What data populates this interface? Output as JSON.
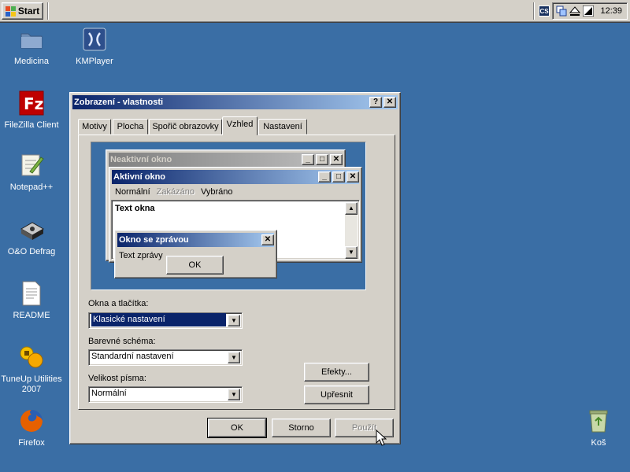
{
  "taskbar": {
    "start_label": "Start",
    "clock": "12:39",
    "tray_icons": [
      "cs-icon",
      "network-icon",
      "eject-icon",
      "volume-icon"
    ],
    "cs_label": "CS"
  },
  "desktop": {
    "icons": [
      {
        "label": "Medicina",
        "icon": "folder-icon"
      },
      {
        "label": "KMPlayer",
        "icon": "kmplayer-icon"
      },
      {
        "label": "FileZilla Client",
        "icon": "filezilla-icon"
      },
      {
        "label": "Notepad++",
        "icon": "notepadpp-icon"
      },
      {
        "label": "O&O Defrag",
        "icon": "defrag-icon"
      },
      {
        "label": "README",
        "icon": "document-icon"
      },
      {
        "label": "TuneUp Utilities 2007",
        "icon": "tuneup-icon"
      },
      {
        "label": "Firefox",
        "icon": "firefox-icon"
      },
      {
        "label": "Koš",
        "icon": "recycle-bin-icon"
      }
    ]
  },
  "dialog": {
    "title": "Zobrazení - vlastnosti",
    "help_label": "?",
    "close_label": "✕",
    "tabs": [
      "Motivy",
      "Plocha",
      "Spořič obrazovky",
      "Vzhled",
      "Nastavení"
    ],
    "active_tab": "Vzhled",
    "preview": {
      "inactive_title": "Neaktivní okno",
      "active_title": "Aktivní okno",
      "menu": {
        "normal": "Normální",
        "disabled": "Zakázáno",
        "selected": "Vybráno"
      },
      "window_text": "Text okna",
      "message_title": "Okno se zprávou",
      "message_text": "Text zprávy",
      "message_ok": "OK"
    },
    "fields": {
      "windows_buttons_label": "Okna a tlačítka:",
      "windows_buttons_value": "Klasické nastavení",
      "color_scheme_label": "Barevné schéma:",
      "color_scheme_value": "Standardní nastavení",
      "font_size_label": "Velikost písma:",
      "font_size_value": "Normální"
    },
    "buttons": {
      "effects": "Efekty...",
      "advanced": "Upřesnit",
      "ok": "OK",
      "cancel": "Storno",
      "apply": "Použít"
    }
  },
  "colors": {
    "desktop": "#3a6ea5",
    "active_title_start": "#0a246a",
    "active_title_end": "#a6caf0",
    "inactive_title_start": "#808080",
    "inactive_title_end": "#c0c0c0",
    "face": "#d4d0c8"
  }
}
